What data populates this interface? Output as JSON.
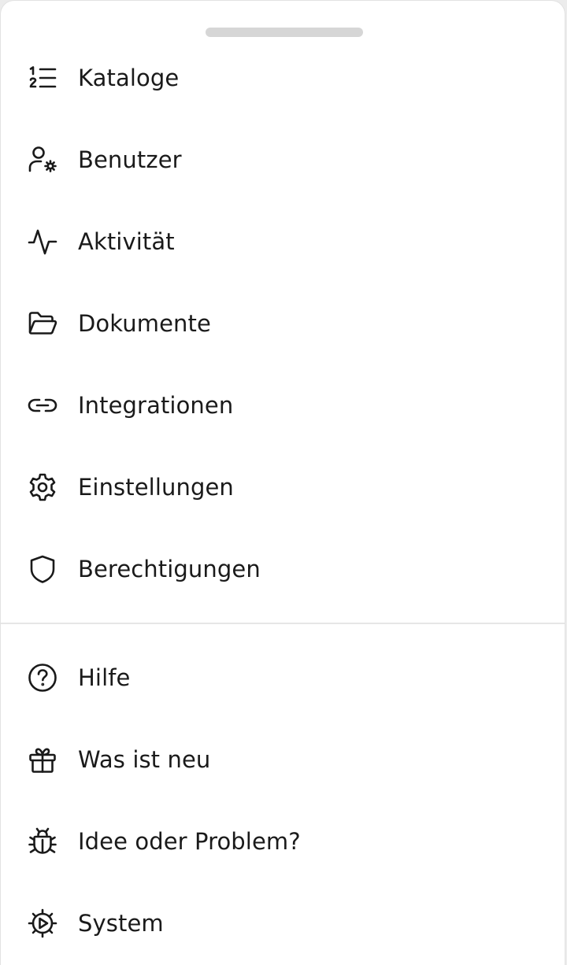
{
  "menu": {
    "main": [
      {
        "label": "Kataloge",
        "icon": "numbered-list-icon"
      },
      {
        "label": "Benutzer",
        "icon": "user-settings-icon"
      },
      {
        "label": "Aktivität",
        "icon": "activity-icon"
      },
      {
        "label": "Dokumente",
        "icon": "folder-open-icon"
      },
      {
        "label": "Integrationen",
        "icon": "link-icon"
      },
      {
        "label": "Einstellungen",
        "icon": "gear-icon"
      },
      {
        "label": "Berechtigungen",
        "icon": "shield-icon"
      }
    ],
    "secondary": [
      {
        "label": "Hilfe",
        "icon": "help-circle-icon"
      },
      {
        "label": "Was ist neu",
        "icon": "gift-icon"
      },
      {
        "label": "Idee oder Problem?",
        "icon": "bug-icon"
      },
      {
        "label": "System",
        "icon": "system-gear-icon"
      }
    ]
  }
}
